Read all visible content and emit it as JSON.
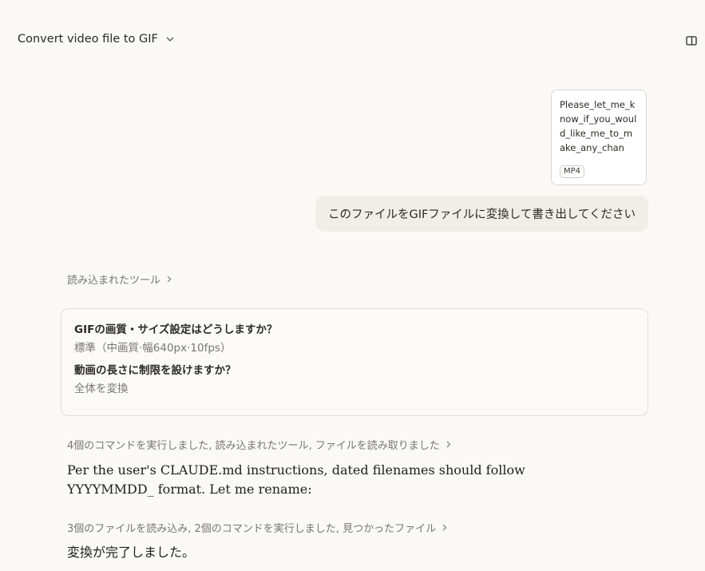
{
  "header": {
    "title": "Convert video file to GIF"
  },
  "attachment": {
    "file_name": "Please_let_me_know_if_you_would_like_me_to_make_any_chang…",
    "file_type": "MP4"
  },
  "user_message": {
    "text": "このファイルをGIFファイルに変換して書き出してください"
  },
  "steps": {
    "tools_loaded": "読み込まれたツール",
    "step2": "4個のコマンドを実行しました, 読み込まれたツール, ファイルを読み取りました",
    "step3": "3個のファイルを読み込み, 2個のコマンドを実行しました, 見つかったファイル"
  },
  "qa": [
    {
      "question": "GIFの画質・サイズ設定はどうしますか？",
      "answer": "標準（中画質·幅640px·10fps）"
    },
    {
      "question": "動画の長さに制限を設けますか？",
      "answer": "全体を変換"
    }
  ],
  "assistant": {
    "message1": "Per the user's CLAUDE.md instructions, dated filenames should follow YYYYMMDD_ format. Let me rename:",
    "message2": "変換が完了しました。"
  },
  "icons": {
    "title_dropdown": "chevron-down-icon",
    "sidebar_toggle": "sidebar-toggle-icon",
    "step_expand": "chevron-right-icon"
  }
}
